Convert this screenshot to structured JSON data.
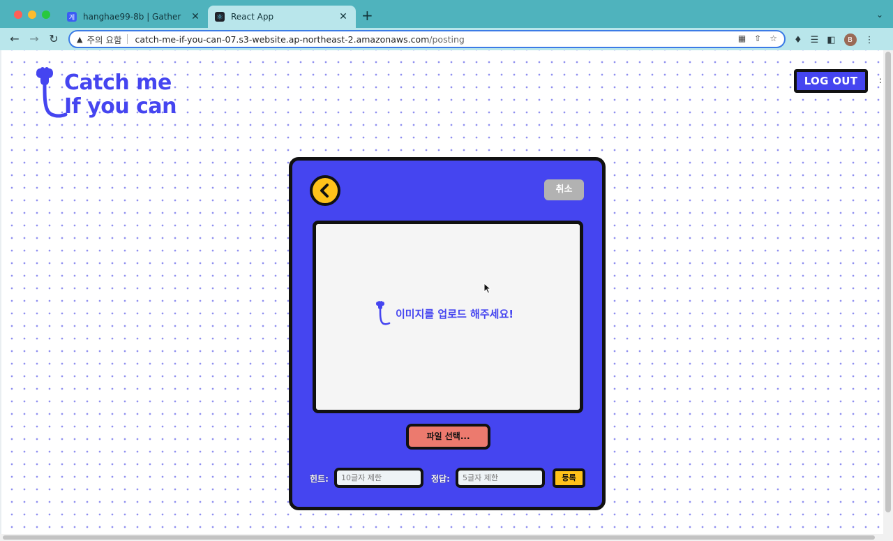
{
  "browser": {
    "tabs": [
      {
        "title": "hanghae99-8b | Gather",
        "favicon": "gather-favicon",
        "favicon_glyph": "게",
        "active": false
      },
      {
        "title": "React App",
        "favicon": "react-favicon",
        "favicon_glyph": "⚛",
        "active": true
      }
    ],
    "new_tab_label": "+",
    "close_label": "✕",
    "omnibox": {
      "security_warning": "주의 요함",
      "url_host": "catch-me-if-you-can-07.s3-website.ap-northeast-2.amazonaws.com",
      "url_path": "/posting"
    },
    "profile_initial": "B"
  },
  "page": {
    "logo": {
      "line1": "Catch me",
      "line2": "If you can"
    },
    "logout_label": "LOG OUT",
    "card": {
      "cancel_label": "취소",
      "upload_prompt": "이미지를 업로드 해주세요!",
      "file_button_label": "파일 선택...",
      "hint_label": "힌트:",
      "hint_placeholder": "10글자 제한",
      "answer_label": "정답:",
      "answer_placeholder": "5글자 제한",
      "submit_label": "등록"
    }
  },
  "colors": {
    "brand_blue": "#4545f0",
    "accent_yellow": "#ffc21a",
    "file_button_coral": "#ec7a6e",
    "cancel_gray": "#b2b2b2",
    "tab_bar_teal": "#4fb3bd"
  }
}
